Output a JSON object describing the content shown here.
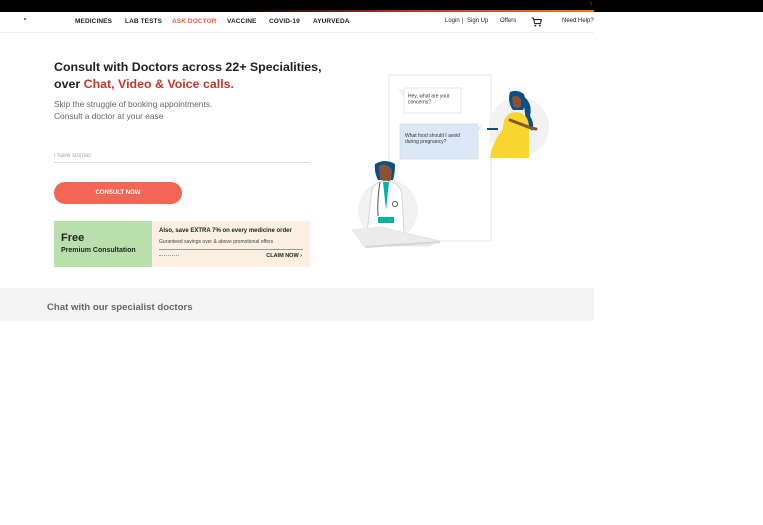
{
  "nav": {
    "items": [
      {
        "label": "MEDICINES",
        "active": false
      },
      {
        "label": "LAB TESTS",
        "active": false
      },
      {
        "label": "ASK DOCTOR",
        "active": true
      },
      {
        "label": "VACCINE",
        "active": false
      },
      {
        "label": "COVID-19",
        "active": false
      },
      {
        "label": "AYURVEDA",
        "active": false
      }
    ],
    "login": "Login",
    "separator": "|",
    "signup": "Sign Up",
    "offers": "Offers",
    "cart_icon": "cart-icon",
    "help": "Need Help?"
  },
  "hero": {
    "title_line1": "Consult with Doctors across 22+ Specialities,",
    "title_line2_prefix": "over ",
    "title_line2_highlight": "Chat, Video & Voice calls.",
    "subtitle_line1": "Skip the struggle of booking appointments.",
    "subtitle_line2": "Consult a doctor at your ease",
    "input_placeholder": "I have stomac",
    "button": "CONSULT NOW"
  },
  "promo": {
    "free": "Free",
    "premium": "Premium Consultation",
    "headline": "Also, save EXTRA 7% on every medicine order",
    "sub": "Guranteed savings over & above promotional offers",
    "cta": "CLAIM NOW ›"
  },
  "illustration": {
    "bubble1": "Hey, what are your concerns?",
    "bubble2": "What food should I avoid during pregnancy?"
  },
  "section": {
    "title": "Chat with our specialist doctors"
  },
  "colors": {
    "accent": "#ef5b4a",
    "button": "#f26656",
    "highlight": "#c0392b",
    "promo_green": "#b9e0ac",
    "promo_cream": "#fcf0e2"
  }
}
